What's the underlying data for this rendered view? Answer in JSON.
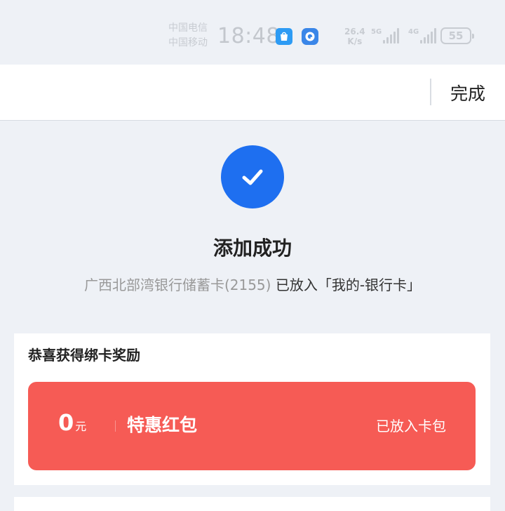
{
  "status_bar": {
    "carrier_1": "中国电信",
    "carrier_2": "中国移动",
    "time": "18:48",
    "speed_value": "26.4",
    "speed_unit": "K/s",
    "network_1": "5G",
    "network_2": "4G",
    "battery": "55",
    "icons": [
      "app-store-icon",
      "browser-icon",
      "signal-icon",
      "signal-icon",
      "battery-icon"
    ]
  },
  "header": {
    "done_label": "完成"
  },
  "success": {
    "icon": "check-icon",
    "icon_color": "#1e6ff0",
    "title": "添加成功",
    "card_name": "广西北部湾银行储蓄卡(2155)",
    "placed_text": "已放入「我的-银行卡」"
  },
  "reward": {
    "title": "恭喜获得绑卡奖励",
    "coupon": {
      "amount": "0",
      "unit": "元",
      "name": "特惠红包",
      "status": "已放入卡包",
      "color": "#f65b55"
    }
  }
}
